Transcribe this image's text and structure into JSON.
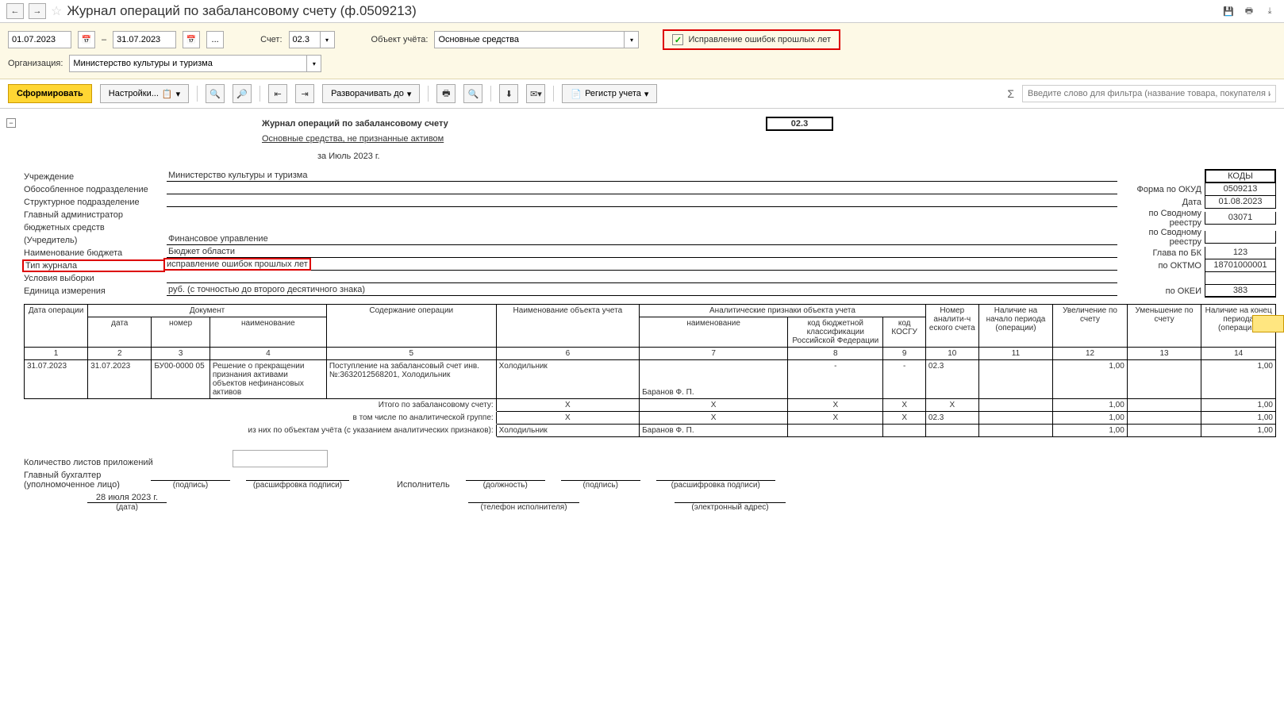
{
  "title": "Журнал операций по забалансовому счету (ф.0509213)",
  "filter": {
    "date_from": "01.07.2023",
    "date_to": "31.07.2023",
    "dash": "–",
    "account_lbl": "Счет:",
    "account": "02.3",
    "object_lbl": "Объект учёта:",
    "object": "Основные средства",
    "errors_chk": "Исправление ошибок прошлых лет",
    "org_lbl": "Организация:",
    "org": "Министерство культуры и туризма"
  },
  "toolbar": {
    "form": "Сформировать",
    "settings": "Настройки...",
    "expand": "Разворачивать до",
    "register": "Регистр учета",
    "filter_ph": "Введите слово для фильтра (название товара, покупателя и пр.)"
  },
  "report": {
    "title": "Журнал операций по забалансовому счету",
    "subtitle": "Основные средства, не признанные активом",
    "period": "за Июль 2023 г.",
    "account_code": "02.3",
    "meta_labels": {
      "inst": "Учреждение",
      "sep": "Обособленное подразделение",
      "struct": "Структурное подразделение",
      "admin1": "Главный администратор",
      "admin2": "бюджетных средств",
      "admin3": "(Учредитель)",
      "budget": "Наименование бюджета",
      "jtype": "Тип журнала",
      "cond": "Условия выборки",
      "unit": "Единица измерения"
    },
    "meta_vals": {
      "inst": "Министерство культуры и туризма",
      "admin": "Финансовое управление",
      "budget": "Бюджет области",
      "jtype": "исправление ошибок прошлых лет",
      "unit": "руб. (с точностью до второго десятичного знака)"
    },
    "codes_lbl": {
      "hdr": "КОДЫ",
      "okud": "Форма по ОКУД",
      "date": "Дата",
      "svod1": "по Сводному реестру",
      "svod2": "по Сводному реестру",
      "glava": "Глава по БК",
      "oktmo": "по ОКТМО",
      "okei": "по ОКЕИ"
    },
    "codes": {
      "okud": "0509213",
      "date": "01.08.2023",
      "svod1": "03071",
      "svod2": "",
      "glava": "123",
      "oktmo": "18701000001",
      "blank": "",
      "okei": "383"
    }
  },
  "thead": {
    "c1": "Дата операции",
    "c2a": "Документ",
    "c2_1": "дата",
    "c2_2": "номер",
    "c2_3": "наименование",
    "c3": "Содержание операции",
    "c4": "Наименование объекта учета",
    "c5a": "Аналитические признаки объекта учета",
    "c5_1": "наименование",
    "c5_2": "код бюджетной классификации Российской Федерации",
    "c5_3": "код КОСГУ",
    "c6": "Номер аналити-ч еского счета",
    "c7": "Наличие на начало периода (операции)",
    "c8": "Увеличение по счету",
    "c9": "Уменьшение по счету",
    "c10": "Наличие на конец периода (операции)",
    "n1": "1",
    "n2": "2",
    "n3": "3",
    "n4": "4",
    "n5": "5",
    "n6": "6",
    "n7": "7",
    "n8": "8",
    "n9": "9",
    "n10": "10",
    "n11": "11",
    "n12": "12",
    "n13": "13",
    "n14": "14"
  },
  "rows": [
    {
      "d1": "31.07.2023",
      "d2": "31.07.2023",
      "num": "БУ00-0000 05",
      "name": "Решение о прекращении признания активами объектов нефинансовых активов",
      "op": "Поступление на забалансовый счет инв. №:3632012568201, Холодильник",
      "obj": "Холодильник",
      "an": "Баранов Ф. П.",
      "kbk": "-",
      "kosgu": "-",
      "acc": "02.3",
      "beg": "",
      "inc": "1,00",
      "dec": "",
      "end": "1,00"
    }
  ],
  "totals": {
    "t1": "Итого по забалансовому счету:",
    "t2": "в том числе по аналитической группе:",
    "t3": "из них по объектам учёта (с указанием аналитических признаков):",
    "x": "Х",
    "v": "1,00",
    "acc": "02.3",
    "obj": "Холодильник",
    "an": "Баранов Ф. П."
  },
  "footer": {
    "sheets": "Количество листов приложений",
    "chief": "Главный бухгалтер",
    "chief2": "(уполномоченное лицо)",
    "sign": "(подпись)",
    "decode": "(расшифровка подписи)",
    "exec": "Исполнитель",
    "pos": "(должность)",
    "phone": "(телефон исполнителя)",
    "email": "(электронный адрес)",
    "date": "28 июля 2023 г.",
    "date_lbl": "(дата)"
  }
}
